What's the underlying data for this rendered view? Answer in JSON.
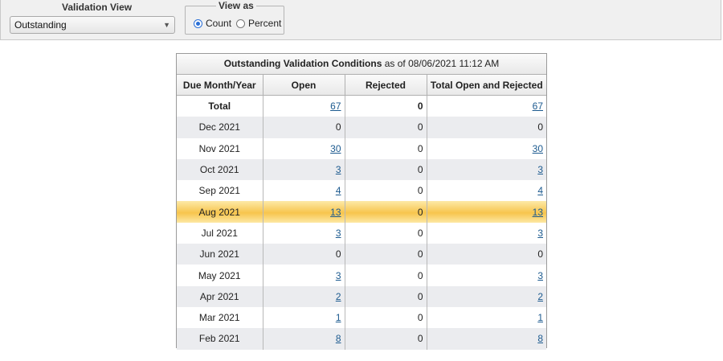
{
  "filters": {
    "validation_view_label": "Validation View",
    "validation_view_value": "Outstanding",
    "view_as_label": "View as",
    "view_as_options": [
      {
        "label": "Count",
        "checked": true
      },
      {
        "label": "Percent",
        "checked": false
      }
    ]
  },
  "table": {
    "caption_bold": "Outstanding Validation Conditions",
    "caption_rest": " as of 08/06/2021 11:12 AM",
    "headers": [
      "Due Month/Year",
      "Open",
      "Rejected",
      "Total Open and Rejected"
    ],
    "rows": [
      {
        "month": "Total",
        "open": "67",
        "rejected": "0",
        "total": "67",
        "open_link": true,
        "total_link": true,
        "style": "total"
      },
      {
        "month": "Dec 2021",
        "open": "0",
        "rejected": "0",
        "total": "0",
        "open_link": false,
        "total_link": false,
        "style": "alt"
      },
      {
        "month": "Nov 2021",
        "open": "30",
        "rejected": "0",
        "total": "30",
        "open_link": true,
        "total_link": true,
        "style": ""
      },
      {
        "month": "Oct 2021",
        "open": "3",
        "rejected": "0",
        "total": "3",
        "open_link": true,
        "total_link": true,
        "style": "alt"
      },
      {
        "month": "Sep 2021",
        "open": "4",
        "rejected": "0",
        "total": "4",
        "open_link": true,
        "total_link": true,
        "style": ""
      },
      {
        "month": "Aug 2021",
        "open": "13",
        "rejected": "0",
        "total": "13",
        "open_link": true,
        "total_link": true,
        "style": "hl"
      },
      {
        "month": "Jul 2021",
        "open": "3",
        "rejected": "0",
        "total": "3",
        "open_link": true,
        "total_link": true,
        "style": ""
      },
      {
        "month": "Jun 2021",
        "open": "0",
        "rejected": "0",
        "total": "0",
        "open_link": false,
        "total_link": false,
        "style": "alt"
      },
      {
        "month": "May 2021",
        "open": "3",
        "rejected": "0",
        "total": "3",
        "open_link": true,
        "total_link": true,
        "style": ""
      },
      {
        "month": "Apr 2021",
        "open": "2",
        "rejected": "0",
        "total": "2",
        "open_link": true,
        "total_link": true,
        "style": "alt"
      },
      {
        "month": "Mar 2021",
        "open": "1",
        "rejected": "0",
        "total": "1",
        "open_link": true,
        "total_link": true,
        "style": ""
      },
      {
        "month": "Feb 2021",
        "open": "8",
        "rejected": "0",
        "total": "8",
        "open_link": true,
        "total_link": true,
        "style": "alt"
      }
    ]
  },
  "colors": {
    "link": "#1c5a8f",
    "highlight": "#f7c54d",
    "alt_row": "#ebecef",
    "radio_accent": "#2a6fd6"
  }
}
